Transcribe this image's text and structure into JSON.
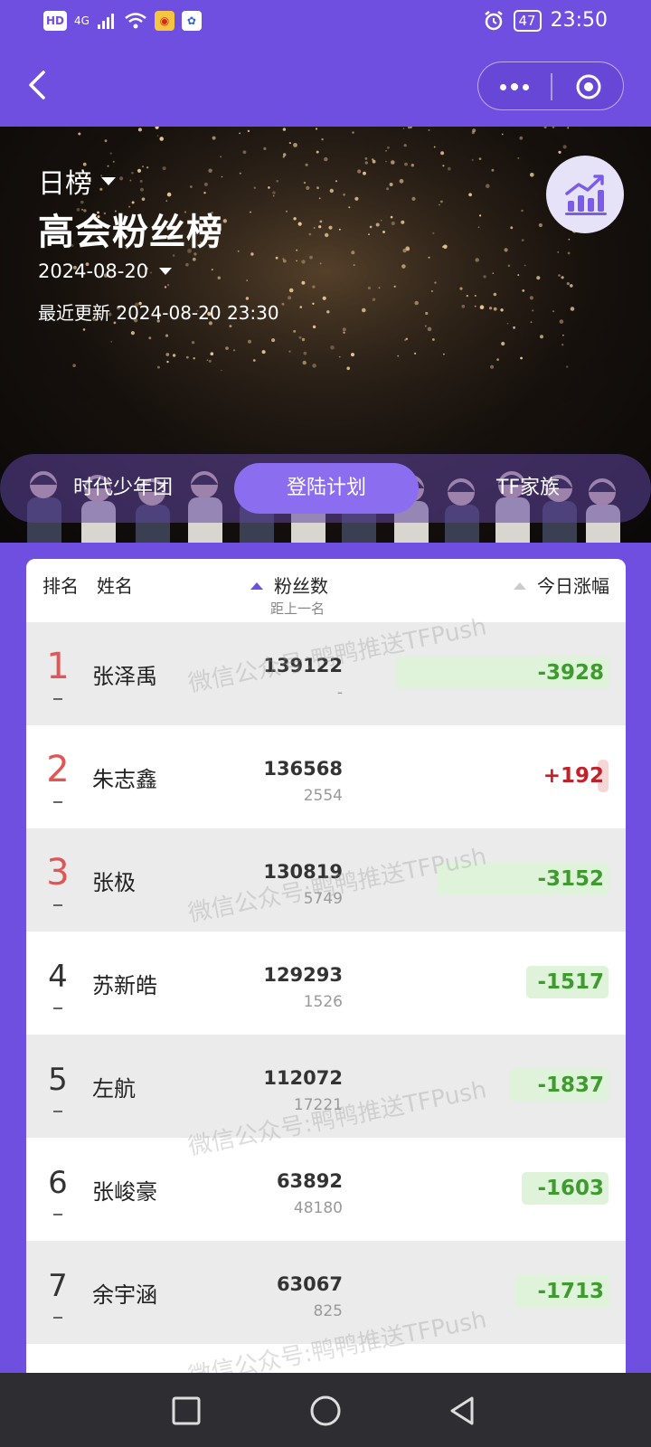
{
  "status_bar": {
    "left_badges": [
      "HD",
      "4G"
    ],
    "battery": "47",
    "time": "23:50"
  },
  "nav": {
    "back_icon": "chevron-left-icon",
    "more_icon": "more-dots-icon",
    "close_icon": "target-circle-icon"
  },
  "hero": {
    "period": "日榜",
    "title": "高会粉丝榜",
    "date": "2024-08-20",
    "updated": "最近更新 2024-08-20 23:30",
    "chart_icon": "bar-chart-trend-icon"
  },
  "tabs": [
    {
      "label": "时代少年团",
      "active": false
    },
    {
      "label": "登陆计划",
      "active": true
    },
    {
      "label": "TF家族",
      "active": false
    }
  ],
  "table": {
    "headers": {
      "rank": "排名",
      "name": "姓名",
      "fans": "粉丝数",
      "fans_sub": "距上一名",
      "change": "今日涨幅"
    },
    "rows": [
      {
        "rank": "1",
        "name": "张泽禹",
        "fans": "139122",
        "gap": "-",
        "change": "-3928"
      },
      {
        "rank": "2",
        "name": "朱志鑫",
        "fans": "136568",
        "gap": "2554",
        "change": "+192"
      },
      {
        "rank": "3",
        "name": "张极",
        "fans": "130819",
        "gap": "5749",
        "change": "-3152"
      },
      {
        "rank": "4",
        "name": "苏新皓",
        "fans": "129293",
        "gap": "1526",
        "change": "-1517"
      },
      {
        "rank": "5",
        "name": "左航",
        "fans": "112072",
        "gap": "17221",
        "change": "-1837"
      },
      {
        "rank": "6",
        "name": "张峻豪",
        "fans": "63892",
        "gap": "48180",
        "change": "-1603"
      },
      {
        "rank": "7",
        "name": "余宇涵",
        "fans": "63067",
        "gap": "825",
        "change": "-1713"
      }
    ]
  },
  "watermark": "微信公众号:鸭鸭推送TFPush",
  "colors": {
    "primary": "#6f4fe0",
    "increase": "#c0222b",
    "decrease": "#3f9b2f",
    "top3_rank": "#e05555"
  }
}
